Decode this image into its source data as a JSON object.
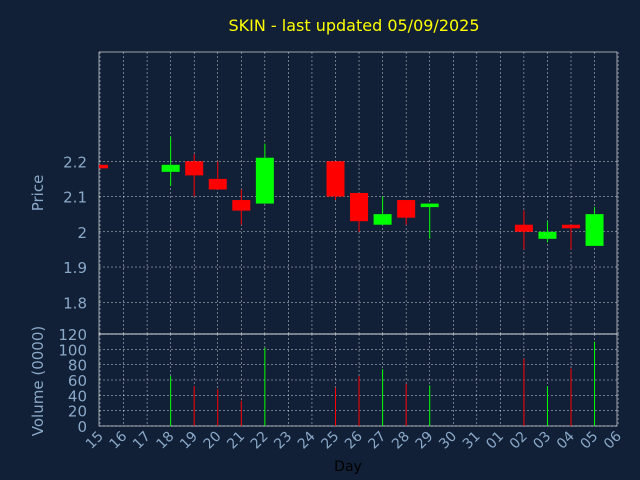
{
  "chart_data": {
    "type": "candlestick",
    "title": "SKIN - last updated 05/09/2025",
    "xlabel": "Day",
    "price_axis": {
      "label": "Price",
      "ylim": [
        1.71,
        2.51
      ],
      "ticks": [
        1.8,
        1.9,
        2,
        2.1,
        2.2
      ],
      "tick_labels": [
        "1.8",
        "1.9",
        "2",
        "2.1",
        "2.2"
      ]
    },
    "volume_axis": {
      "label": "Volume (0000)",
      "ylim": [
        0,
        120
      ],
      "ticks": [
        0,
        20,
        40,
        60,
        80,
        100,
        120
      ],
      "tick_labels": [
        "0",
        "20",
        "40",
        "60",
        "80",
        "100",
        "120"
      ]
    },
    "x_ticks": [
      "15",
      "16",
      "17",
      "18",
      "19",
      "20",
      "21",
      "22",
      "23",
      "24",
      "25",
      "26",
      "27",
      "28",
      "29",
      "30",
      "31",
      "01",
      "02",
      "03",
      "04",
      "05",
      "06"
    ],
    "grid": true,
    "colors": {
      "background": "#112036",
      "title": "#ffff00",
      "axis_text": "#8aa8c8",
      "grid": "#ffffff",
      "up": "#00ff00",
      "down": "#ff0000"
    },
    "candles": [
      {
        "day": "15",
        "open": 2.19,
        "high": 2.19,
        "low": 2.18,
        "close": 2.18,
        "volume": 0
      },
      {
        "day": "18",
        "open": 2.17,
        "high": 2.27,
        "low": 2.13,
        "close": 2.19,
        "volume": 65
      },
      {
        "day": "19",
        "open": 2.2,
        "high": 2.22,
        "low": 2.1,
        "close": 2.16,
        "volume": 52
      },
      {
        "day": "20",
        "open": 2.15,
        "high": 2.2,
        "low": 2.12,
        "close": 2.12,
        "volume": 48
      },
      {
        "day": "21",
        "open": 2.09,
        "high": 2.12,
        "low": 2.02,
        "close": 2.06,
        "volume": 33
      },
      {
        "day": "22",
        "open": 2.08,
        "high": 2.25,
        "low": 2.08,
        "close": 2.21,
        "volume": 102
      },
      {
        "day": "25",
        "open": 2.2,
        "high": 2.2,
        "low": 2.09,
        "close": 2.1,
        "volume": 50
      },
      {
        "day": "26",
        "open": 2.11,
        "high": 2.11,
        "low": 2.0,
        "close": 2.03,
        "volume": 65
      },
      {
        "day": "27",
        "open": 2.02,
        "high": 2.1,
        "low": 2.02,
        "close": 2.05,
        "volume": 74
      },
      {
        "day": "28",
        "open": 2.09,
        "high": 2.09,
        "low": 2.02,
        "close": 2.04,
        "volume": 55
      },
      {
        "day": "29",
        "open": 2.07,
        "high": 2.08,
        "low": 1.98,
        "close": 2.08,
        "volume": 53
      },
      {
        "day": "02",
        "open": 2.02,
        "high": 2.06,
        "low": 1.95,
        "close": 2.0,
        "volume": 88
      },
      {
        "day": "03",
        "open": 1.98,
        "high": 2.03,
        "low": 1.97,
        "close": 2.0,
        "volume": 52
      },
      {
        "day": "04",
        "open": 2.02,
        "high": 2.02,
        "low": 1.95,
        "close": 2.01,
        "volume": 75
      },
      {
        "day": "05",
        "open": 1.96,
        "high": 2.07,
        "low": 1.96,
        "close": 2.05,
        "volume": 110
      }
    ]
  }
}
